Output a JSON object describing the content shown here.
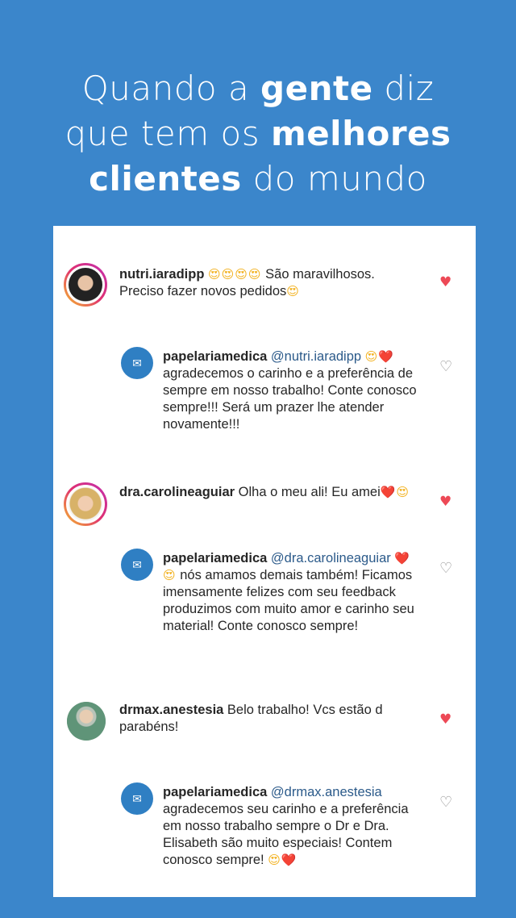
{
  "headline": {
    "line1_a": "Quando a ",
    "line1_b": "gente",
    "line1_c": " diz",
    "line2_a": "que tem os ",
    "line2_b": "melhores",
    "line3_a": "clientes",
    "line3_b": " do mundo"
  },
  "comments": [
    {
      "username": "nutri.iaradipp",
      "text_emoji": "😍😍😍😍",
      "text": " São maravilhosos. Preciso fazer novos pedidos",
      "text_end_emoji": "😍",
      "liked": true,
      "reply": {
        "username": "papelariamedica",
        "mention": "@nutri.iaradipp",
        "mention_emoji": "😍❤️",
        "text": "agradecemos o carinho e a preferência de sempre em nosso trabalho! Conte conosco sempre!!! Será um prazer lhe atender novamente!!!",
        "liked": false
      }
    },
    {
      "username": "dra.carolineaguiar",
      "text": " Olha o meu ali! Eu amei",
      "text_end_emoji": "❤️😍",
      "liked": true,
      "reply": {
        "username": "papelariamedica",
        "mention": "@dra.carolineaguiar",
        "lead_emoji": "❤️😍",
        "text": "  nós amamos  demais também! Ficamos imensamente felizes com seu feedback produzimos com muito amor e carinho seu material!  Conte conosco sempre!",
        "liked": false
      }
    },
    {
      "username": "drmax.anestesia",
      "text": " Belo trabalho! Vcs estão d parabéns!",
      "liked": true,
      "reply": {
        "username": "papelariamedica",
        "mention": "@drmax.anestesia",
        "text": "agradecemos seu carinho  e a preferência em nosso trabalho sempre o Dr e Dra. Elisabeth são muito especiais! Contem conosco sempre! ",
        "text_end_emoji": "😍❤️",
        "liked": false
      }
    }
  ],
  "icons": {
    "heart_filled": "♥",
    "heart_outline": "♡"
  },
  "colors": {
    "background": "#3b86cb",
    "like": "#ed4956",
    "mention": "#2b5a8a"
  }
}
